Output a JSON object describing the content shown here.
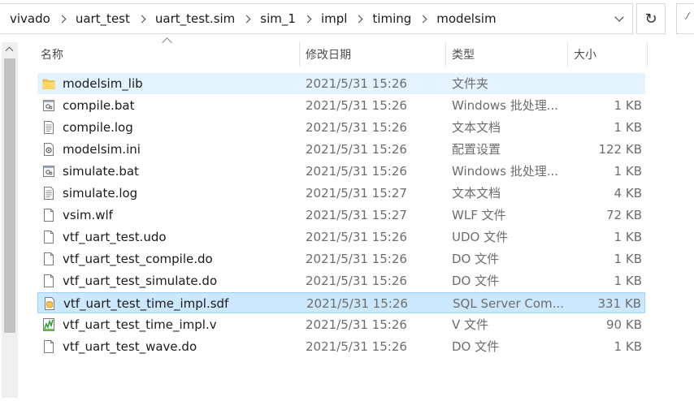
{
  "breadcrumb": [
    "vivado",
    "uart_test",
    "uart_test.sim",
    "sim_1",
    "impl",
    "timing",
    "modelsim"
  ],
  "toolbar": {
    "refresh_icon": "refresh-icon",
    "dropdown_icon": "chevron-down-icon"
  },
  "columns": {
    "name": "名称",
    "date": "修改日期",
    "type": "类型",
    "size": "大小"
  },
  "files": [
    {
      "name": "modelsim_lib",
      "date": "2021/5/31 15:26",
      "type": "文件夹",
      "size": "",
      "icon": "folder"
    },
    {
      "name": "compile.bat",
      "date": "2021/5/31 15:26",
      "type": "Windows 批处理...",
      "size": "1 KB",
      "icon": "bat"
    },
    {
      "name": "compile.log",
      "date": "2021/5/31 15:26",
      "type": "文本文档",
      "size": "1 KB",
      "icon": "text"
    },
    {
      "name": "modelsim.ini",
      "date": "2021/5/31 15:26",
      "type": "配置设置",
      "size": "122 KB",
      "icon": "ini"
    },
    {
      "name": "simulate.bat",
      "date": "2021/5/31 15:26",
      "type": "Windows 批处理...",
      "size": "1 KB",
      "icon": "bat"
    },
    {
      "name": "simulate.log",
      "date": "2021/5/31 15:27",
      "type": "文本文档",
      "size": "4 KB",
      "icon": "text"
    },
    {
      "name": "vsim.wlf",
      "date": "2021/5/31 15:27",
      "type": "WLF 文件",
      "size": "72 KB",
      "icon": "blank"
    },
    {
      "name": "vtf_uart_test.udo",
      "date": "2021/5/31 15:26",
      "type": "UDO 文件",
      "size": "1 KB",
      "icon": "blank"
    },
    {
      "name": "vtf_uart_test_compile.do",
      "date": "2021/5/31 15:26",
      "type": "DO 文件",
      "size": "1 KB",
      "icon": "blank"
    },
    {
      "name": "vtf_uart_test_simulate.do",
      "date": "2021/5/31 15:26",
      "type": "DO 文件",
      "size": "1 KB",
      "icon": "blank"
    },
    {
      "name": "vtf_uart_test_time_impl.sdf",
      "date": "2021/5/31 15:26",
      "type": "SQL Server Com...",
      "size": "331 KB",
      "icon": "sdf"
    },
    {
      "name": "vtf_uart_test_time_impl.v",
      "date": "2021/5/31 15:26",
      "type": "V 文件",
      "size": "90 KB",
      "icon": "v"
    },
    {
      "name": "vtf_uart_test_wave.do",
      "date": "2021/5/31 15:26",
      "type": "DO 文件",
      "size": "1 KB",
      "icon": "blank"
    }
  ],
  "hover_index": 0,
  "selected_index": 10
}
